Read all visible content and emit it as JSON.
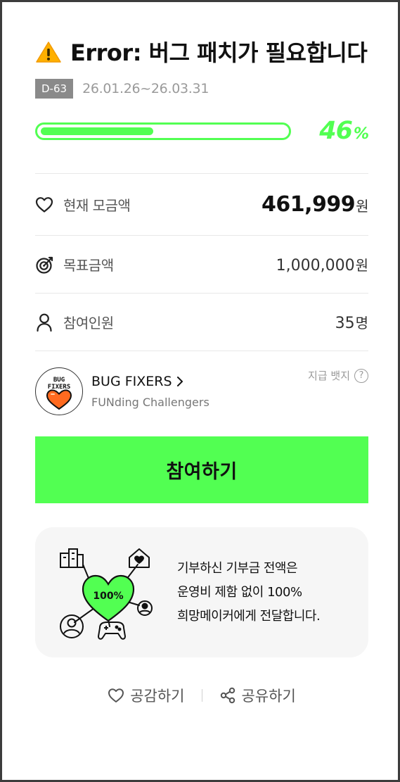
{
  "campaign": {
    "title": "Error: 버그 패치가 필요합니다",
    "title_icon": "warning-icon",
    "d_day": "D-63",
    "period": "26.01.26~26.03.31",
    "progress_percent": 46,
    "progress_number": "46",
    "progress_unit": "%"
  },
  "stats": {
    "current": {
      "icon": "heart-icon",
      "label": "현재 모금액",
      "value": "461,999",
      "unit": "원"
    },
    "goal": {
      "icon": "target-icon",
      "label": "목표금액",
      "value": "1,000,000",
      "unit": "원"
    },
    "participants": {
      "icon": "person-icon",
      "label": "참여인원",
      "value": "35",
      "unit": "명"
    }
  },
  "creator": {
    "logo_text_line1": "BUG",
    "logo_text_line2": "FIXERS",
    "name": "BUG FIXERS",
    "subtitle": "FUNding Challengers",
    "badge_link": "지급 뱃지",
    "help_glyph": "?"
  },
  "join_button": {
    "label": "참여하기"
  },
  "info_card": {
    "illustration_text": "100%",
    "lines": [
      "기부하신 기부금 전액은",
      "운영비 제함 없이 100%",
      "희망메이커에게 전달합니다."
    ]
  },
  "actions": {
    "like_label": "공감하기",
    "share_label": "공유하기"
  },
  "colors": {
    "accent": "#52ff52",
    "badge_gray": "#8a8a8a",
    "card_bg": "#f6f6f6"
  }
}
